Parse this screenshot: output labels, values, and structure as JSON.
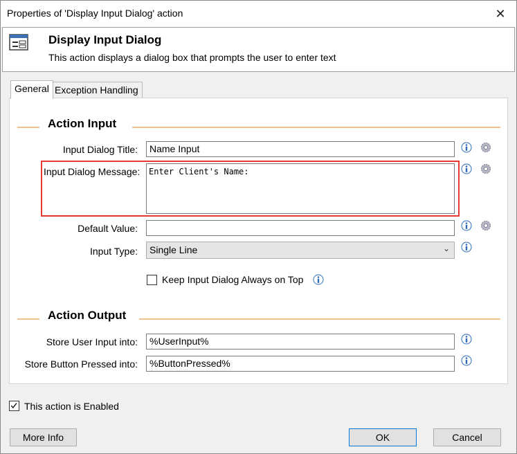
{
  "window": {
    "title": "Properties of 'Display Input Dialog' action"
  },
  "header": {
    "title": "Display Input Dialog",
    "description": "This action displays a dialog box that prompts the user to enter text"
  },
  "tabs": [
    {
      "label": "General",
      "active": true
    },
    {
      "label": "Exception Handling",
      "active": false
    }
  ],
  "action_input": {
    "section_title": "Action Input",
    "dialog_title": {
      "label": "Input Dialog Title:",
      "value": "Name Input"
    },
    "dialog_message": {
      "label": "Input Dialog Message:",
      "value": "Enter Client's Name:"
    },
    "default_value": {
      "label": "Default Value:",
      "value": ""
    },
    "input_type": {
      "label": "Input Type:",
      "value": "Single Line"
    },
    "keep_on_top": {
      "label": "Keep Input Dialog Always on Top",
      "checked": false
    }
  },
  "action_output": {
    "section_title": "Action Output",
    "store_input": {
      "label": "Store User Input into:",
      "value": "%UserInput%"
    },
    "store_button": {
      "label": "Store Button Pressed into:",
      "value": "%ButtonPressed%"
    }
  },
  "footer": {
    "enabled_label": "This action is Enabled",
    "enabled_checked": true,
    "more_info": "More Info",
    "ok": "OK",
    "cancel": "Cancel"
  },
  "colors": {
    "section_line": "#f2c18d",
    "highlight": "#e53935",
    "info_blue": "#2a6ab8"
  }
}
